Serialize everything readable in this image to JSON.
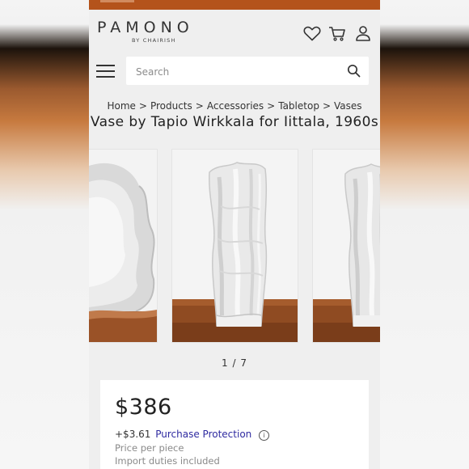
{
  "brand": {
    "name": "PAMONO",
    "tagline": "BY CHAIRISH"
  },
  "header": {
    "icons": [
      "heart-icon",
      "cart-icon",
      "user-icon"
    ]
  },
  "search": {
    "placeholder": "Search"
  },
  "breadcrumb": {
    "items": [
      "Home",
      "Products",
      "Accessories",
      "Tabletop",
      "Vases"
    ],
    "separator": ">"
  },
  "product": {
    "title": "Vase by Tapio Wirkkala for Iittala, 1960s",
    "price": "$386",
    "protection_price": "+$3.61",
    "protection_label": "Purchase Protection",
    "price_note": "Price per piece",
    "duties_note": "Import duties included"
  },
  "gallery": {
    "counter": "1 / 7",
    "current": 1,
    "total": 7
  },
  "colors": {
    "topbar": "#b4531b",
    "link": "#2e2aa0",
    "background": "#efefef"
  }
}
